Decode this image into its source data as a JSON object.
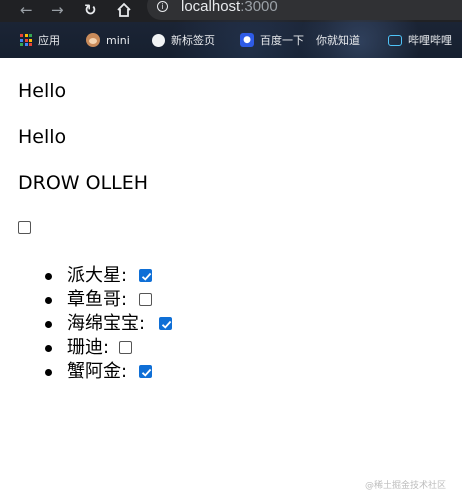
{
  "browser": {
    "url_host": "localhost",
    "url_port": ":3000",
    "bookmarks": [
      {
        "label": "应用",
        "icon": "apps-grid-icon"
      },
      {
        "label": "mini",
        "icon": "monkey-icon"
      },
      {
        "label": "新标签页",
        "icon": "new-tab-icon"
      },
      {
        "label": "百度一下",
        "icon": "baidu-icon"
      },
      {
        "label": "你就知道",
        "icon": "zhihu-icon"
      },
      {
        "label": "哔哩哔哩",
        "icon": "bilibili-icon"
      }
    ]
  },
  "page": {
    "hello_line_1": "Hello",
    "hello_line_2": "Hello",
    "reversed_line": "DROW OLLEH",
    "toggle_all_checked": false,
    "todos": [
      {
        "label": "派大星:",
        "checked": true
      },
      {
        "label": "章鱼哥:",
        "checked": false
      },
      {
        "label": "海绵宝宝:",
        "checked": true
      },
      {
        "label": "珊迪:",
        "checked": false
      },
      {
        "label": "蟹阿金:",
        "checked": true
      }
    ]
  },
  "watermark": "@稀土掘金技术社区",
  "colors": {
    "checkbox_checked": "#0f6fd6",
    "chrome_dark": "#202124"
  }
}
